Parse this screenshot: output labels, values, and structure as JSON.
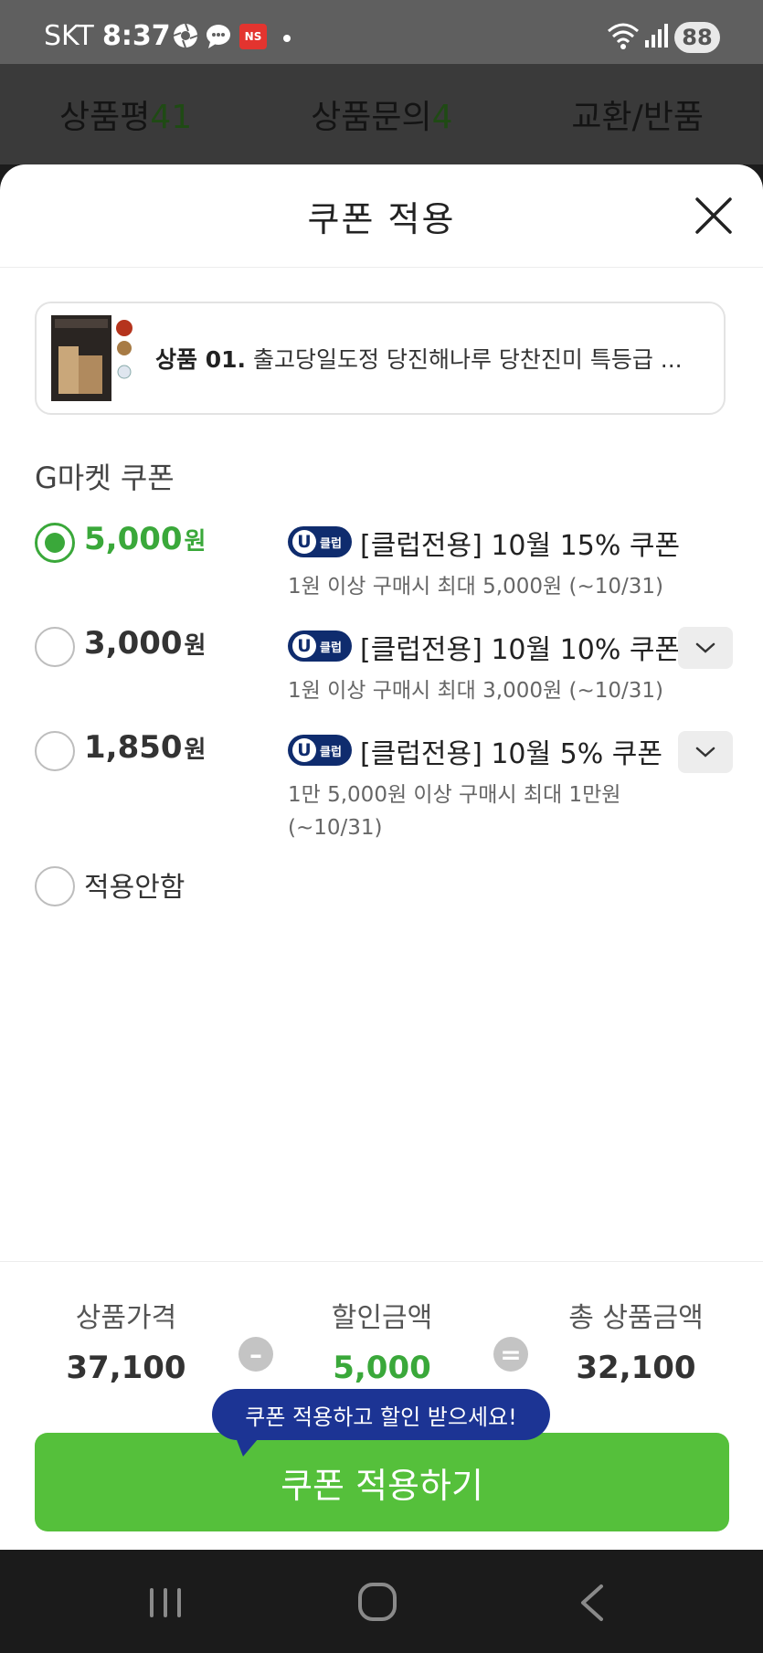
{
  "status_bar": {
    "carrier": "SKT",
    "time": "8:37",
    "ns_badge": "NS",
    "battery": "88"
  },
  "bg_tabs": [
    {
      "label": "상품평",
      "count": "41"
    },
    {
      "label": "상품문의",
      "count": "4"
    },
    {
      "label": "교환/반품",
      "count": ""
    }
  ],
  "sheet": {
    "title": "쿠폰 적용",
    "product": {
      "prefix": "상품 01.",
      "name": "출고당일도정 당진해나루 당찬진미 특등급 ..."
    },
    "section_title": "G마켓 쿠폰",
    "coupons": [
      {
        "amount": "5,000",
        "unit": "원",
        "badge": "클럽",
        "badge_letter": "U",
        "name": "[클럽전용] 10월 15% 쿠폰",
        "desc": "1원 이상 구매시 최대 5,000원 (~10/31)",
        "selected": true
      },
      {
        "amount": "3,000",
        "unit": "원",
        "badge": "클럽",
        "badge_letter": "U",
        "name": "[클럽전용] 10월 10% 쿠폰",
        "desc": "1원 이상 구매시 최대 3,000원 (~10/31)",
        "selected": false
      },
      {
        "amount": "1,850",
        "unit": "원",
        "badge": "클럽",
        "badge_letter": "U",
        "name": "[클럽전용] 10월 5% 쿠폰",
        "desc": "1만 5,000원 이상 구매시 최대 1만원 (~10/31)",
        "selected": false
      }
    ],
    "no_apply_label": "적용안함",
    "summary": {
      "price_label": "상품가격",
      "price": "37,100",
      "discount_label": "할인금액",
      "discount": "5,000",
      "total_label": "총 상품금액",
      "total": "32,100"
    },
    "tooltip": "쿠폰 적용하고 할인 받으세요!",
    "apply_button": "쿠폰 적용하기"
  },
  "colors": {
    "accent_green": "#3aa83a",
    "button_green": "#55c03b",
    "tooltip_blue": "#1c3494",
    "club_navy": "#0f2c6e"
  },
  "icons": [
    "close-icon",
    "chevron-down-icon",
    "recents-icon",
    "home-icon",
    "back-icon"
  ]
}
